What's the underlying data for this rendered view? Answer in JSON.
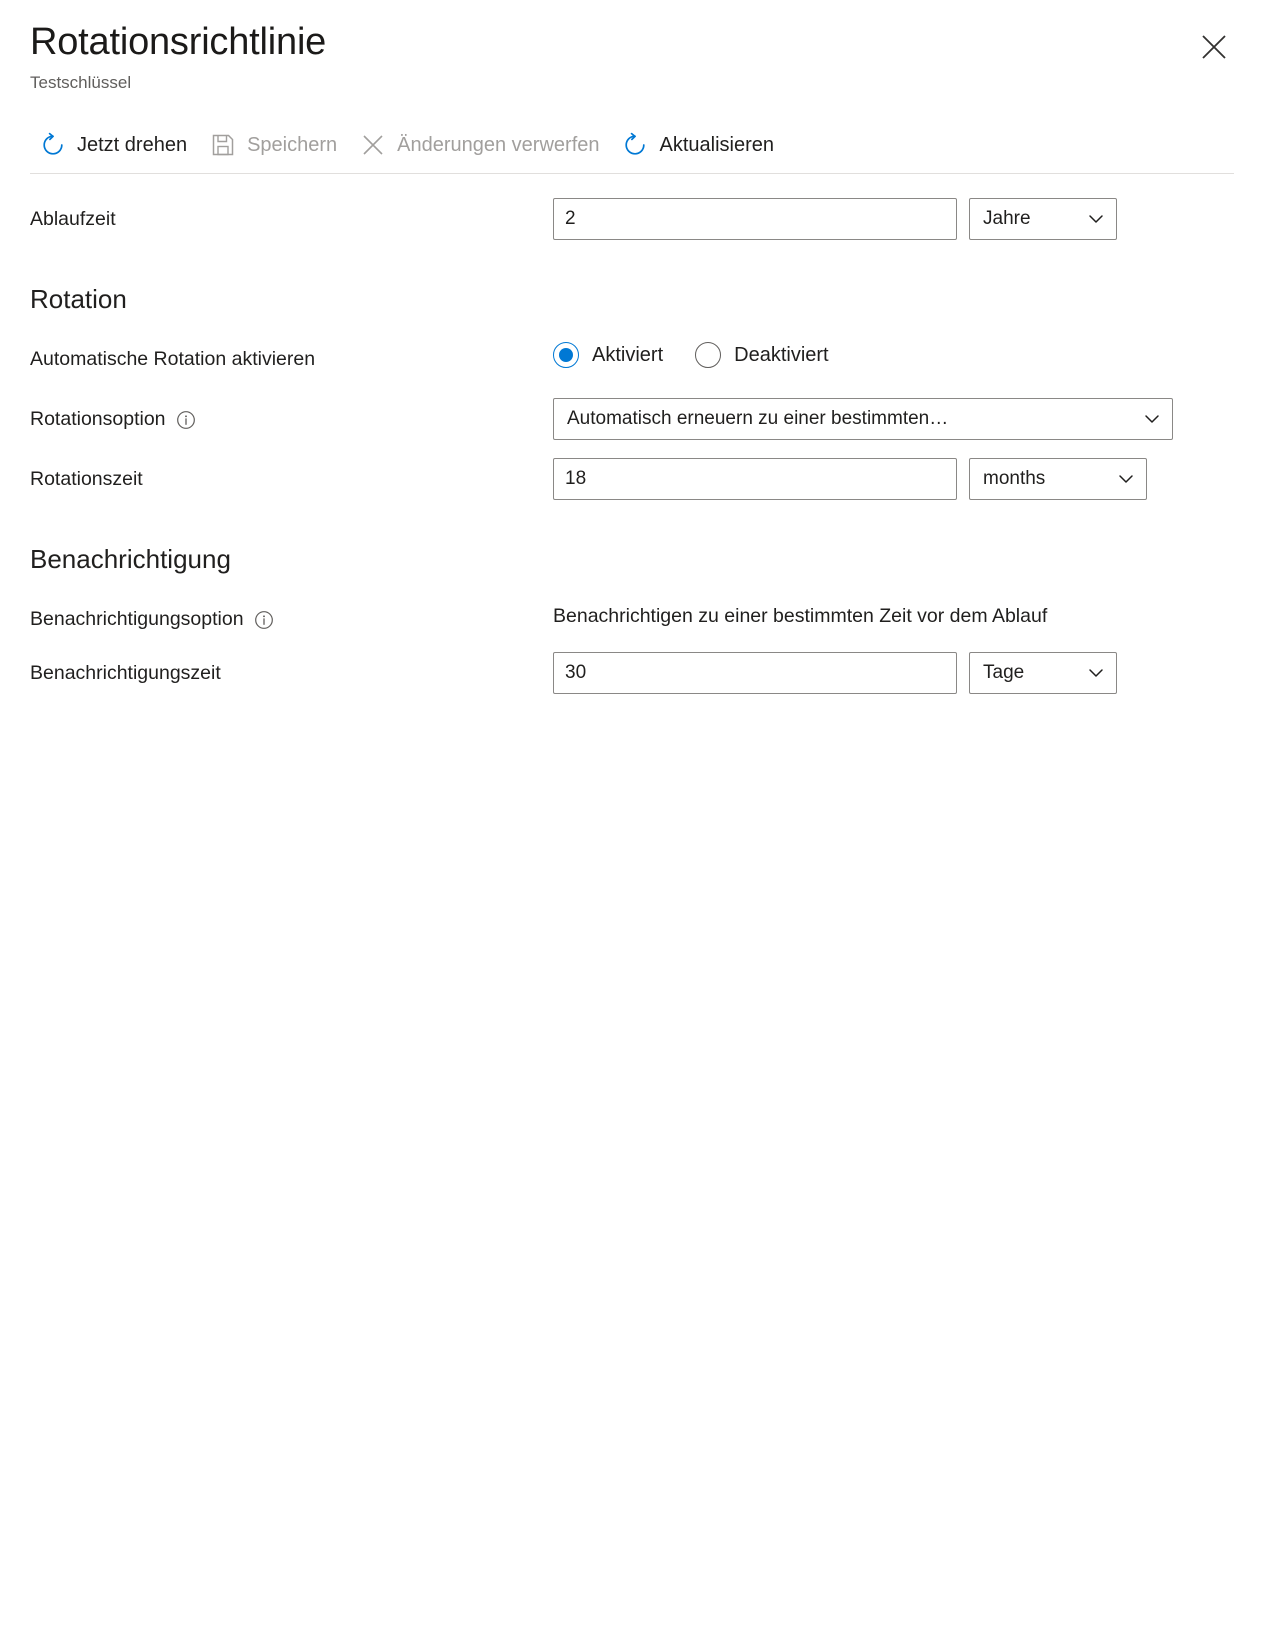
{
  "header": {
    "title": "Rotationsrichtlinie",
    "subtitle": "Testschlüssel",
    "close_icon": "close-icon"
  },
  "toolbar": {
    "items": [
      {
        "label": "Jetzt drehen",
        "icon": "rotate-icon",
        "disabled": false
      },
      {
        "label": "Speichern",
        "icon": "save-disk-icon",
        "disabled": true
      },
      {
        "label": "Änderungen verwerfen",
        "icon": "discard-x-icon",
        "disabled": true
      },
      {
        "label": "Aktualisieren",
        "icon": "refresh-icon",
        "disabled": false
      }
    ]
  },
  "expiry": {
    "label": "Ablaufzeit",
    "value": "2",
    "unit": "Jahre"
  },
  "rotation": {
    "section_title": "Rotation",
    "enable_label": "Automatische Rotation aktivieren",
    "options": [
      {
        "label": "Aktiviert",
        "checked": true
      },
      {
        "label": "Deaktiviert",
        "checked": false
      }
    ],
    "option_label": "Rotationsoption",
    "option_info_icon": "info-icon",
    "option_value": "Automatisch erneuern zu einer bestimmten…",
    "time_label": "Rotationszeit",
    "time_value": "18",
    "time_unit": "months"
  },
  "notification": {
    "section_title": "Benachrichtigung",
    "option_label": "Benachrichtigungsoption",
    "option_info_icon": "info-icon",
    "option_text": "Benachrichtigen zu einer bestimmten Zeit vor dem Ablauf",
    "time_label": "Benachrichtigungszeit",
    "time_value": "30",
    "time_unit": "Tage"
  },
  "colors": {
    "accent": "#0078d4",
    "text": "#201f1e",
    "muted": "#605e5c",
    "disabled": "#a19f9d",
    "border": "#8a8886",
    "divider": "#e1dfdd"
  }
}
